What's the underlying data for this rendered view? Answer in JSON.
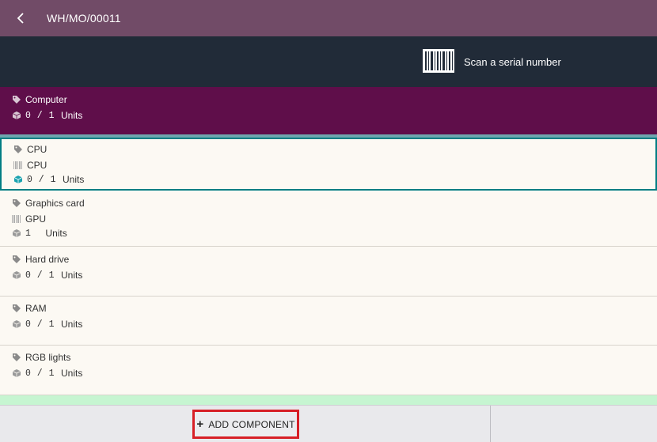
{
  "header": {
    "title": "WH/MO/00011"
  },
  "scan": {
    "label": "Scan a serial number"
  },
  "main_line": {
    "product": "Computer",
    "qty": "0 / 1",
    "uom": "Units"
  },
  "components": [
    {
      "product": "CPU",
      "lot": "CPU",
      "qty": "0 / 1",
      "uom": "Units"
    },
    {
      "product": "Graphics card",
      "lot": "GPU",
      "qty": "1",
      "uom": "Units"
    },
    {
      "product": "Hard drive",
      "qty": "0 / 1",
      "uom": "Units"
    },
    {
      "product": "RAM",
      "qty": "0 / 1",
      "uom": "Units"
    },
    {
      "product": "RGB lights",
      "qty": "0 / 1",
      "uom": "Units"
    }
  ],
  "footer": {
    "add_component_label": "ADD COMPONENT"
  },
  "colors": {
    "header_bg": "#714b67",
    "scan_bg": "#212b38",
    "main_line_bg": "#5f0e4a",
    "selected_border": "#017e84",
    "highlight_red": "#d71f26"
  },
  "icons": {
    "back": "chevron-left-icon",
    "barcode": "barcode-icon",
    "tag": "tags-icon",
    "lot": "barcode-small-icon",
    "qty": "cube-icon",
    "add": "plus-icon"
  }
}
